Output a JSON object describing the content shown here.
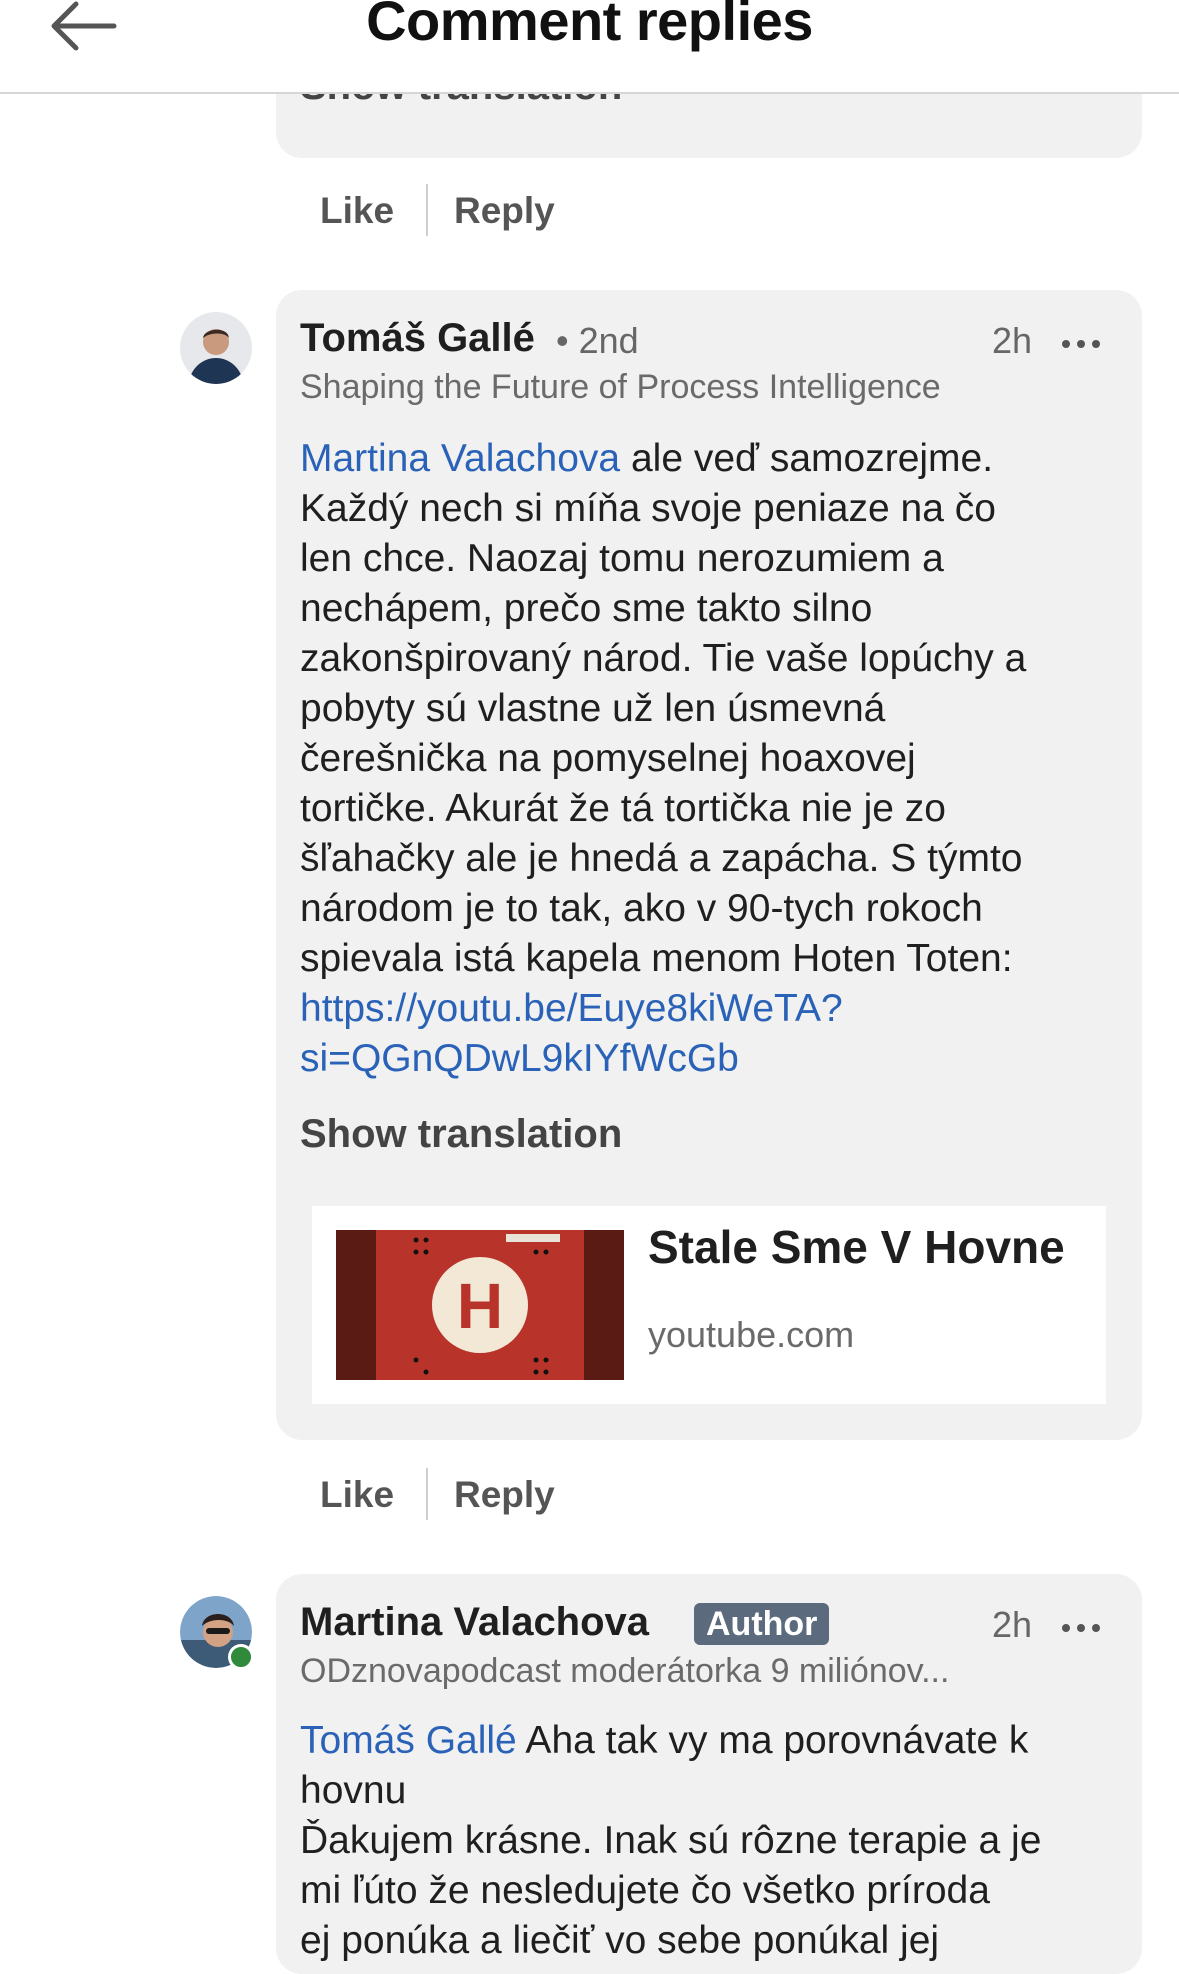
{
  "header": {
    "title": "Comment replies"
  },
  "prev_comment": {
    "show_translation_cut": "Show translation",
    "like_label": "Like",
    "reply_label": "Reply"
  },
  "comment1": {
    "name": "Tomáš Gallé",
    "degree": "• 2nd",
    "time": "2h",
    "headline": "Shaping the Future of Process Intelligence",
    "mention": "Martina Valachova",
    "lines": [
      " ale veď samozrejme.",
      "Každý nech si míňa svoje peniaze na čo",
      "len chce. Naozaj tomu nerozumiem a",
      "nechápem, prečo sme takto silno",
      "zakonšpirovaný národ. Tie vaše lopúchy a",
      "pobyty sú vlastne už len úsmevná",
      "čerešnička na pomyselnej hoaxovej",
      "tortičke. Akurát že tá tortička nie je zo",
      "šľahačky ale je hnedá a zapácha. S týmto",
      "národom je to tak, ako v 90-tych rokoch",
      "spievala istá kapela menom Hoten Toten:"
    ],
    "link_line1": "https://youtu.be/Euye8kiWeTA?",
    "link_line2": "si=QGnQDwL9kIYfWcGb",
    "show_translation": "Show translation",
    "card": {
      "title": "Stale Sme V Hovne",
      "domain": "youtube.com"
    },
    "like_label": "Like",
    "reply_label": "Reply"
  },
  "comment2": {
    "name": "Martina Valachova",
    "badge": "Author",
    "time": "2h",
    "headline": "ODznovapodcast moderátorka 9 miliónov...",
    "mention": "Tomáš Gallé",
    "line1_rest": " Aha tak vy ma porovnávate k",
    "line2": "hovnu",
    "line3": "Ďakujem krásne. Inak sú rôzne terapie a je",
    "line4": "mi ľúto že nesledujete čo všetko príroda",
    "line5": "ej ponúka a liečiť vo sebe ponúkal jej"
  },
  "colors": {
    "link": "#2a62b8",
    "badge_bg": "#5b6b7d",
    "bubble_bg": "#f1f1f1"
  },
  "icons": [
    "back-arrow-icon",
    "more-options-icon"
  ]
}
